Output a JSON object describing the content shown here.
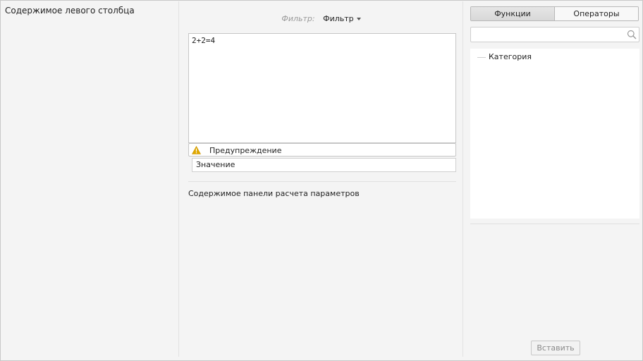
{
  "left_column": {
    "title": "Содержимое левого столбца"
  },
  "middle_column": {
    "filter": {
      "label": "Фильтр:",
      "value": "Фильтр"
    },
    "expression": "2+2=4",
    "warning": {
      "text": "Предупреждение",
      "icon": "warning-icon",
      "color": "#e0a800"
    },
    "value_field": "Значение",
    "params_title": "Содержимое панели расчета параметров"
  },
  "right_column": {
    "tabs": [
      {
        "label": "Функции",
        "active": true
      },
      {
        "label": "Операторы",
        "active": false
      }
    ],
    "search": {
      "value": "",
      "placeholder": ""
    },
    "tree": [
      {
        "label": "Категория"
      }
    ],
    "insert_button": {
      "label": "Вставить",
      "disabled": true
    }
  }
}
